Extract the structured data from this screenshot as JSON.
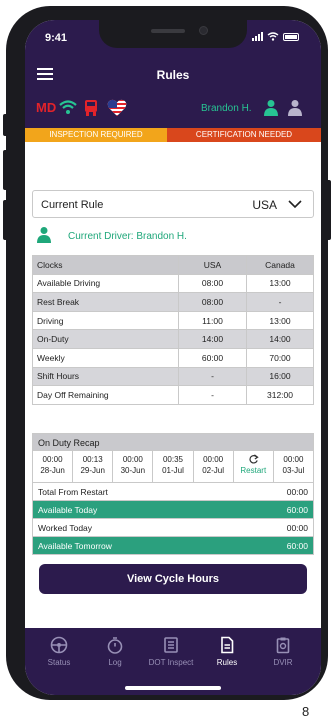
{
  "status_bar": {
    "time": "9:41"
  },
  "header": {
    "title": "Rules"
  },
  "driver_bar": {
    "mode": "MD",
    "driver_name": "Brandon H."
  },
  "banners": {
    "left": "INSPECTION REQUIRED",
    "right": "CERTIFICATION NEEDED"
  },
  "rule_selector": {
    "label": "Current Rule",
    "value": "USA"
  },
  "current_driver": "Current Driver: Brandon H.",
  "clocks": {
    "headers": [
      "Clocks",
      "USA",
      "Canada"
    ],
    "rows": [
      {
        "label": "Available Driving",
        "usa": "08:00",
        "canada": "13:00"
      },
      {
        "label": "Rest Break",
        "usa": "08:00",
        "canada": "-"
      },
      {
        "label": "Driving",
        "usa": "11:00",
        "canada": "13:00"
      },
      {
        "label": "On-Duty",
        "usa": "14:00",
        "canada": "14:00"
      },
      {
        "label": "Weekly",
        "usa": "60:00",
        "canada": "70:00"
      },
      {
        "label": "Shift Hours",
        "usa": "-",
        "canada": "16:00"
      },
      {
        "label": "Day Off Remaining",
        "usa": "-",
        "canada": "312:00"
      }
    ]
  },
  "recap": {
    "title": "On Duty Recap",
    "days": [
      {
        "time": "00:00",
        "date": "28-Jun"
      },
      {
        "time": "00:13",
        "date": "29-Jun"
      },
      {
        "time": "00:00",
        "date": "30-Jun"
      },
      {
        "time": "00:35",
        "date": "01-Jul"
      },
      {
        "time": "00:00",
        "date": "02-Jul"
      },
      {
        "time": "",
        "date": "Restart"
      },
      {
        "time": "00:00",
        "date": "03-Jul"
      }
    ],
    "rows": [
      {
        "label": "Total From Restart",
        "value": "00:00"
      },
      {
        "label": "Available Today",
        "value": "60:00"
      },
      {
        "label": "Worked Today",
        "value": "00:00"
      },
      {
        "label": "Available Tomorrow",
        "value": "60:00"
      }
    ]
  },
  "cta": {
    "label": "View Cycle Hours"
  },
  "tabs": [
    {
      "label": "Status"
    },
    {
      "label": "Log"
    },
    {
      "label": "DOT Inspect"
    },
    {
      "label": "Rules"
    },
    {
      "label": "DVIR"
    }
  ],
  "page_number": "8",
  "colors": {
    "brand_dark": "#2c1b4d",
    "accent_green": "#2ba07e",
    "alert_red": "#e2232a",
    "banner_orange": "#f2a51b",
    "banner_red": "#d9471c"
  }
}
